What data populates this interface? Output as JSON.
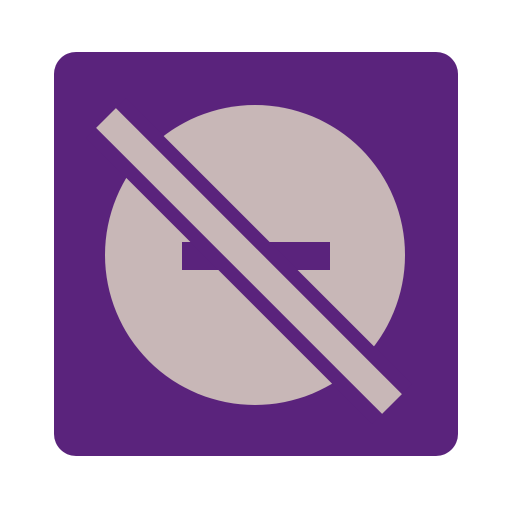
{
  "icon": {
    "name": "do-not-disturb-off-icon",
    "background_color": "#5a237c",
    "glyph_color": "#c8b7b7"
  }
}
